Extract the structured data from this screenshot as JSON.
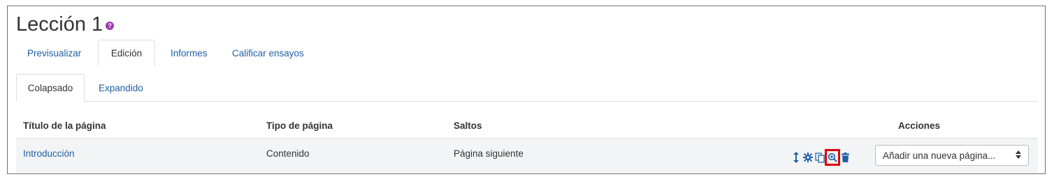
{
  "page": {
    "title": "Lección 1",
    "help_icon": "question-icon"
  },
  "tabs_primary": [
    {
      "label": "Previsualizar",
      "active": false
    },
    {
      "label": "Edición",
      "active": true
    },
    {
      "label": "Informes",
      "active": false
    },
    {
      "label": "Calificar ensayos",
      "active": false
    }
  ],
  "tabs_secondary": [
    {
      "label": "Colapsado",
      "active": true
    },
    {
      "label": "Expandido",
      "active": false
    }
  ],
  "table": {
    "headers": [
      "Título de la página",
      "Tipo de página",
      "Saltos",
      "Acciones"
    ],
    "rows": [
      {
        "title": "Introducción",
        "type": "Contenido",
        "jumps": "Página siguiente"
      }
    ]
  },
  "actions": {
    "icons": [
      "move-icon",
      "gear-icon",
      "copy-icon",
      "zoom-icon",
      "trash-icon"
    ],
    "select_value": "Añadir una nueva página...",
    "highlight_color": "#e00000"
  },
  "colors": {
    "link": "#1f5fa6",
    "help": "#9e3bb0"
  }
}
